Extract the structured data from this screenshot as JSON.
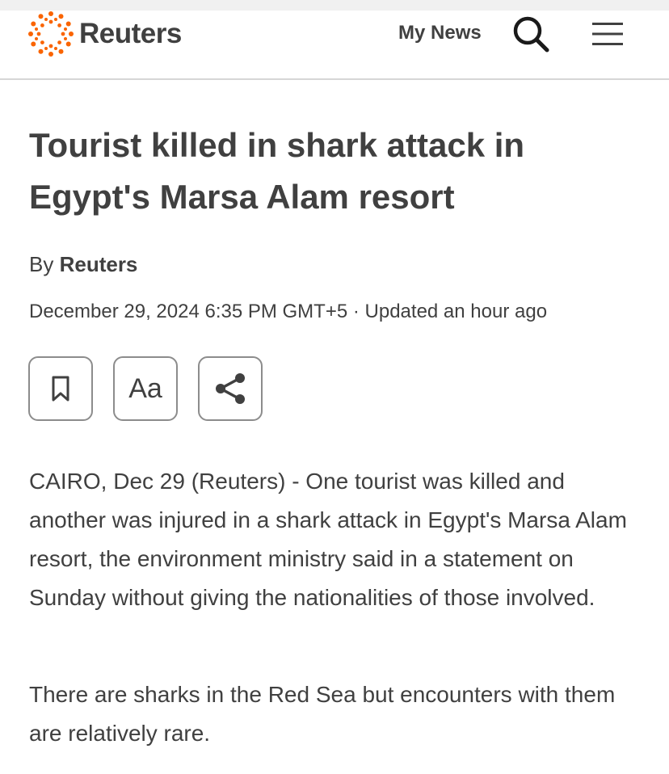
{
  "header": {
    "brand": "Reuters",
    "my_news_label": "My News",
    "accent_color": "#fa6400"
  },
  "article": {
    "headline": "Tourist killed in shark attack in Egypt's Marsa Alam resort",
    "byline_prefix": "By",
    "byline_author": "Reuters",
    "dateline": "December 29, 2024 6:35 PM GMT+5 · Updated an hour ago",
    "paragraphs": [
      "CAIRO, Dec 29 (Reuters) - One tourist was killed and another was injured in a shark attack in Egypt's Marsa Alam resort, the environment ministry said in a statement on Sunday without giving the nationalities of those involved.",
      "There are sharks in the Red Sea but encounters with them are relatively rare."
    ]
  },
  "toolbar": {
    "buttons": [
      {
        "icon": "bookmark-icon"
      },
      {
        "label": "Aa",
        "icon": "text-size"
      },
      {
        "icon": "share-icon"
      }
    ]
  }
}
